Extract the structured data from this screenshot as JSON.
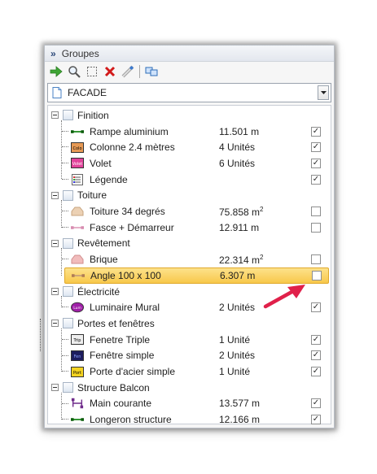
{
  "panel": {
    "title": "Groupes",
    "collapse_glyph": "»"
  },
  "toolbar": {
    "icons": [
      "green-arrow-icon",
      "magnifier-icon",
      "select-rect-icon",
      "delete-x-icon",
      "measure-tool-icon",
      "screens-icon"
    ]
  },
  "combo": {
    "value": "FACADE"
  },
  "colors": {
    "selection": "#f8c84b",
    "annotation_arrow": "#e0204a"
  },
  "groups": [
    {
      "label": "Finition",
      "items": [
        {
          "label": "Rampe aluminium",
          "value": "11.501 m",
          "checked": true,
          "icon": "green-line-icon"
        },
        {
          "label": "Colonne 2.4 mètres",
          "value": "4 Unités",
          "checked": true,
          "icon": "colonne-icon"
        },
        {
          "label": "Volet",
          "value": "6 Unités",
          "checked": true,
          "icon": "volet-icon"
        },
        {
          "label": "Légende",
          "value": "",
          "checked": true,
          "icon": "legend-icon"
        }
      ]
    },
    {
      "label": "Toiture",
      "items": [
        {
          "label": "Toiture 34 degrés",
          "value": "75.858 m",
          "sup": "2",
          "checked": false,
          "icon": "roof-area-icon"
        },
        {
          "label": "Fasce + Démarreur",
          "value": "12.911 m",
          "checked": false,
          "icon": "pink-line-icon"
        }
      ]
    },
    {
      "label": "Revêtement",
      "items": [
        {
          "label": "Brique",
          "value": "22.314 m",
          "sup": "2",
          "checked": false,
          "icon": "brick-area-icon"
        },
        {
          "label": "Angle 100 x 100",
          "value": "6.307 m",
          "checked": false,
          "icon": "angle-line-icon",
          "selected": true
        }
      ]
    },
    {
      "label": "Électricité",
      "items": [
        {
          "label": "Luminaire Mural",
          "value": "2 Unités",
          "checked": true,
          "icon": "luminaire-icon"
        }
      ]
    },
    {
      "label": "Portes et fenêtres",
      "items": [
        {
          "label": "Fenetre Triple",
          "value": "1 Unité",
          "checked": true,
          "icon": "triple-icon"
        },
        {
          "label": "Fenêtre simple",
          "value": "2 Unités",
          "checked": true,
          "icon": "fenetre-icon"
        },
        {
          "label": "Porte d'acier simple",
          "value": "1 Unité",
          "checked": true,
          "icon": "porte-icon"
        }
      ]
    },
    {
      "label": "Structure Balcon",
      "items": [
        {
          "label": "Main courante",
          "value": "13.577 m",
          "checked": true,
          "icon": "handrail-icon"
        },
        {
          "label": "Longeron structure",
          "value": "12.166 m",
          "checked": true,
          "icon": "green-line-icon"
        }
      ]
    }
  ]
}
